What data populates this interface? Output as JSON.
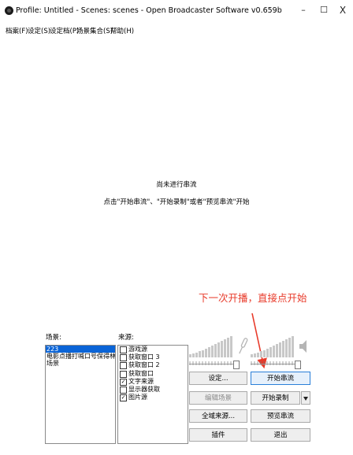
{
  "window": {
    "title": "Profile: Untitled - Scenes: scenes - Open Broadcaster Software v0.659b",
    "minimize_glyph": "–",
    "maximize_glyph": "☐",
    "close_glyph": "X"
  },
  "menu": [
    {
      "label": "档案(F)"
    },
    {
      "label": "设定(S)"
    },
    {
      "label": "设定档(P)"
    },
    {
      "label": "场景集合(S)"
    },
    {
      "label": "帮助(H)"
    }
  ],
  "preview": {
    "status_line1": "尚未进行串流",
    "status_line2": "点击\"开始串流\"、\"开始录制\"或者\"预览串流\"开始"
  },
  "annotation": {
    "text": "下一次开播，直接点开始",
    "color": "#e83a2a"
  },
  "scenes": {
    "label": "场景:",
    "items": [
      {
        "label": "223",
        "selected": true
      },
      {
        "label": "电影点播打喊口号保得林石好",
        "selected": false
      },
      {
        "label": "场景",
        "selected": false
      }
    ]
  },
  "sources": {
    "label": "来源:",
    "items": [
      {
        "label": "游戏源",
        "checked": false
      },
      {
        "label": "获取窗口 3",
        "checked": false
      },
      {
        "label": "获取窗口 2",
        "checked": false
      },
      {
        "label": "获取窗口",
        "checked": false
      },
      {
        "label": "文字来源",
        "checked": true
      },
      {
        "label": "显示器获取",
        "checked": false
      },
      {
        "label": "图片源",
        "checked": true
      }
    ]
  },
  "buttons": {
    "settings": "设定...",
    "start_stream": "开始串流",
    "edit_scene": "编辑场景",
    "start_record": "开始录制",
    "global_sources": "全域来源...",
    "preview_stream": "预览串流",
    "plugins": "插件",
    "exit": "退出"
  },
  "colors": {
    "selection": "#0a64d7",
    "primary_border": "#2a7fd8",
    "meter_bar": "#c8c8c8"
  },
  "icons": {
    "mic": "microphone-icon",
    "speaker": "speaker-icon"
  }
}
